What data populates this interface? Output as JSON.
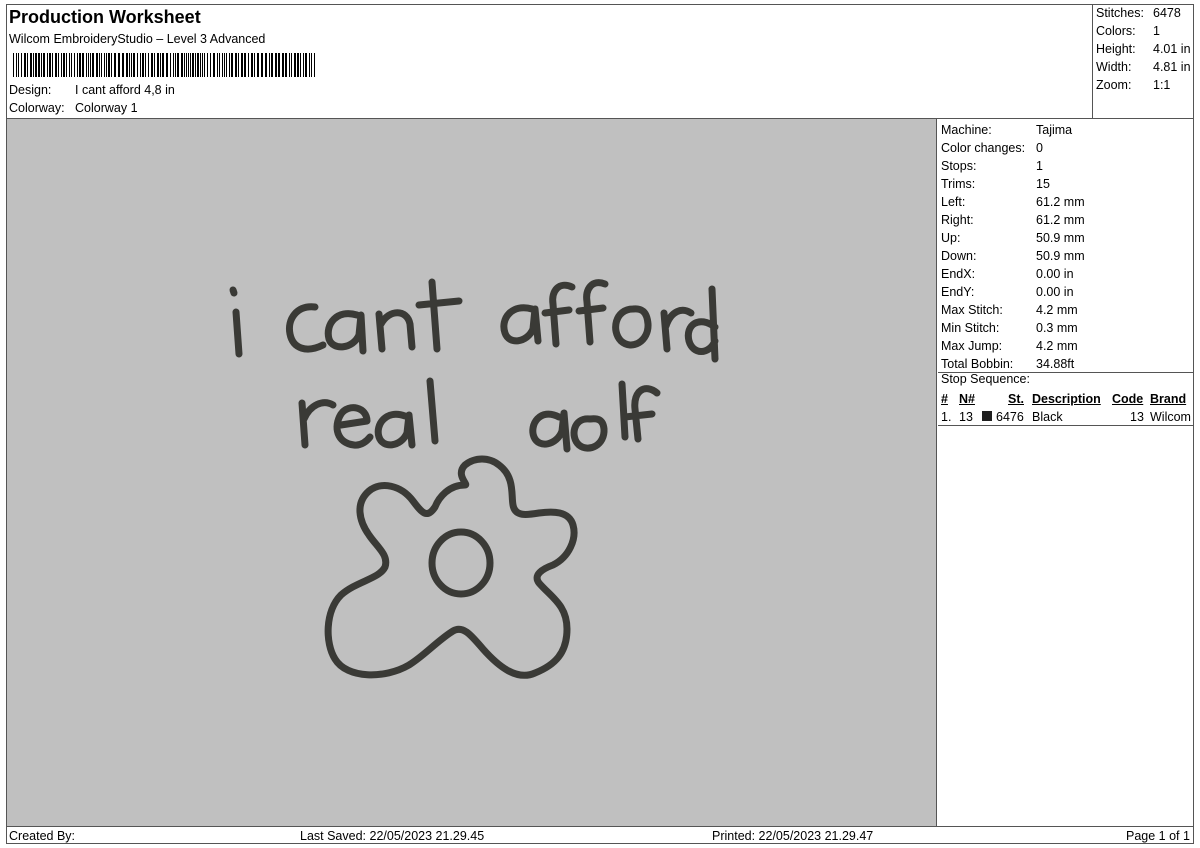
{
  "header": {
    "title": "Production Worksheet",
    "subtitle": "Wilcom EmbroideryStudio – Level 3 Advanced",
    "design_label": "Design:",
    "design_value": "I cant afford 4,8 in",
    "colorway_label": "Colorway:",
    "colorway_value": "Colorway 1"
  },
  "summary": {
    "stitches_label": "Stitches:",
    "stitches": "6478",
    "colors_label": "Colors:",
    "colors": "1",
    "height_label": "Height:",
    "height": "4.01 in",
    "width_label": "Width:",
    "width": "4.81 in",
    "zoom_label": "Zoom:",
    "zoom": "1:1"
  },
  "design": {
    "line1": "i cant afford",
    "line2": "real golf",
    "thread_color": "#3a3a36",
    "background_color": "#c0c0c0"
  },
  "machine": {
    "rows": [
      {
        "label": "Machine:",
        "value": "Tajima"
      },
      {
        "label": "Color changes:",
        "value": "0"
      },
      {
        "label": "Stops:",
        "value": "1"
      },
      {
        "label": "Trims:",
        "value": "15"
      },
      {
        "label": "Left:",
        "value": "61.2 mm"
      },
      {
        "label": "Right:",
        "value": "61.2 mm"
      },
      {
        "label": "Up:",
        "value": "50.9 mm"
      },
      {
        "label": "Down:",
        "value": "50.9 mm"
      },
      {
        "label": "EndX:",
        "value": "0.00 in"
      },
      {
        "label": "EndY:",
        "value": "0.00 in"
      },
      {
        "label": "Max Stitch:",
        "value": "4.2 mm"
      },
      {
        "label": "Min Stitch:",
        "value": "0.3 mm"
      },
      {
        "label": "Max Jump:",
        "value": "4.2 mm"
      },
      {
        "label": "Total Bobbin:",
        "value": "34.88ft"
      }
    ]
  },
  "stop_sequence": {
    "title": "Stop Sequence:",
    "headers": {
      "index": "#",
      "needle": "N#",
      "stitches": "St.",
      "description": "Description",
      "code": "Code",
      "brand": "Brand"
    },
    "rows": [
      {
        "index": "1.",
        "needle": "13",
        "stitches": "6476",
        "description": "Black",
        "code": "13",
        "brand": "Wilcom",
        "swatch": "#1f1f1f"
      }
    ]
  },
  "footer": {
    "created_by": "Created By:",
    "last_saved": "Last Saved: 22/05/2023 21.29.45",
    "printed": "Printed: 22/05/2023 21.29.47",
    "page": "Page 1 of 1"
  }
}
